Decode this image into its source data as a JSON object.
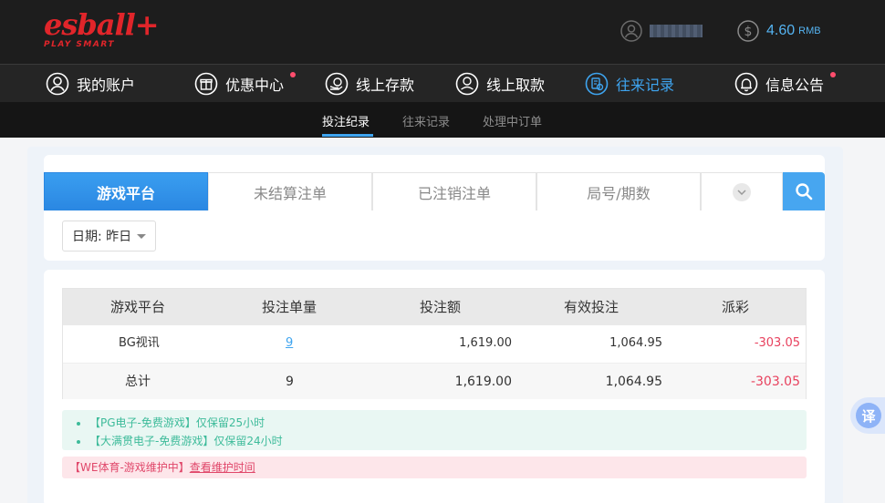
{
  "brand": {
    "logo_main": "esball+",
    "logo_sub": "PLAY SMART"
  },
  "account": {
    "balance": "4.60",
    "currency": "RMB"
  },
  "main_nav": [
    {
      "label": "我的账户",
      "icon": "user-icon",
      "active": false,
      "dot": false
    },
    {
      "label": "优惠中心",
      "icon": "gift-icon",
      "active": false,
      "dot": true
    },
    {
      "label": "线上存款",
      "icon": "deposit-icon",
      "active": false,
      "dot": false
    },
    {
      "label": "线上取款",
      "icon": "withdraw-icon",
      "active": false,
      "dot": false
    },
    {
      "label": "往来记录",
      "icon": "records-icon",
      "active": true,
      "dot": false
    },
    {
      "label": "信息公告",
      "icon": "bell-icon",
      "active": false,
      "dot": true
    }
  ],
  "sub_nav": [
    {
      "label": "投注纪录",
      "active": true
    },
    {
      "label": "往来记录",
      "active": false
    },
    {
      "label": "处理中订单",
      "active": false
    }
  ],
  "tabs": [
    {
      "label": "游戏平台",
      "active": true
    },
    {
      "label": "未结算注单",
      "active": false
    },
    {
      "label": "已注销注单",
      "active": false
    },
    {
      "label": "局号/期数",
      "active": false
    }
  ],
  "date_filter": {
    "label": "日期: 昨日"
  },
  "table": {
    "headers": [
      "游戏平台",
      "投注单量",
      "投注额",
      "有效投注",
      "派彩"
    ],
    "rows": [
      {
        "platform": "BG视讯",
        "count": "9",
        "amount": "1,619.00",
        "valid": "1,064.95",
        "payout": "-303.05"
      }
    ],
    "total": {
      "label": "总计",
      "count": "9",
      "amount": "1,619.00",
      "valid": "1,064.95",
      "payout": "-303.05"
    }
  },
  "notices": {
    "green": [
      "【PG电子-免费游戏】仅保留25小时",
      "【大满贯电子-免费游戏】仅保留24小时"
    ],
    "red_text": "【WE体育-游戏维护中】",
    "red_link": "查看维护时间"
  },
  "translate": {
    "label": "译"
  },
  "colors": {
    "accent": "#3ea4ef",
    "negative": "#e8415e",
    "brand": "#e0252a",
    "notice_green": "#3dbb9a"
  }
}
